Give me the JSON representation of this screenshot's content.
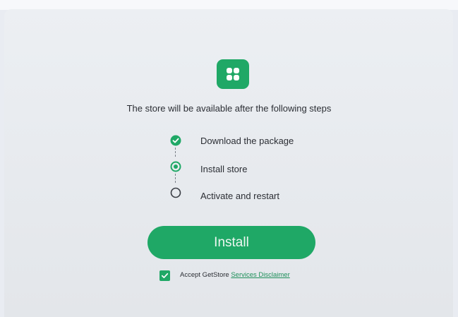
{
  "store": {
    "icon": "clover-four-squares-icon",
    "headline": "The store will be available after the following steps"
  },
  "steps": [
    {
      "label": "Download the package",
      "status": "completed",
      "icon": "check-circle-icon"
    },
    {
      "label": "Install store",
      "status": "in-progress",
      "icon": "radio-active-icon"
    },
    {
      "label": "Activate and restart",
      "status": "pending",
      "icon": "empty-circle-icon"
    }
  ],
  "actions": {
    "install_label": "Install"
  },
  "agreement": {
    "checked": true,
    "prefix": "Accept GetStore",
    "link_label": "Services Disclaimer"
  },
  "colors": {
    "accent": "#1fa866",
    "background": "#e9ecf2",
    "text": "#2b2e34",
    "link": "#1e8f5a"
  }
}
